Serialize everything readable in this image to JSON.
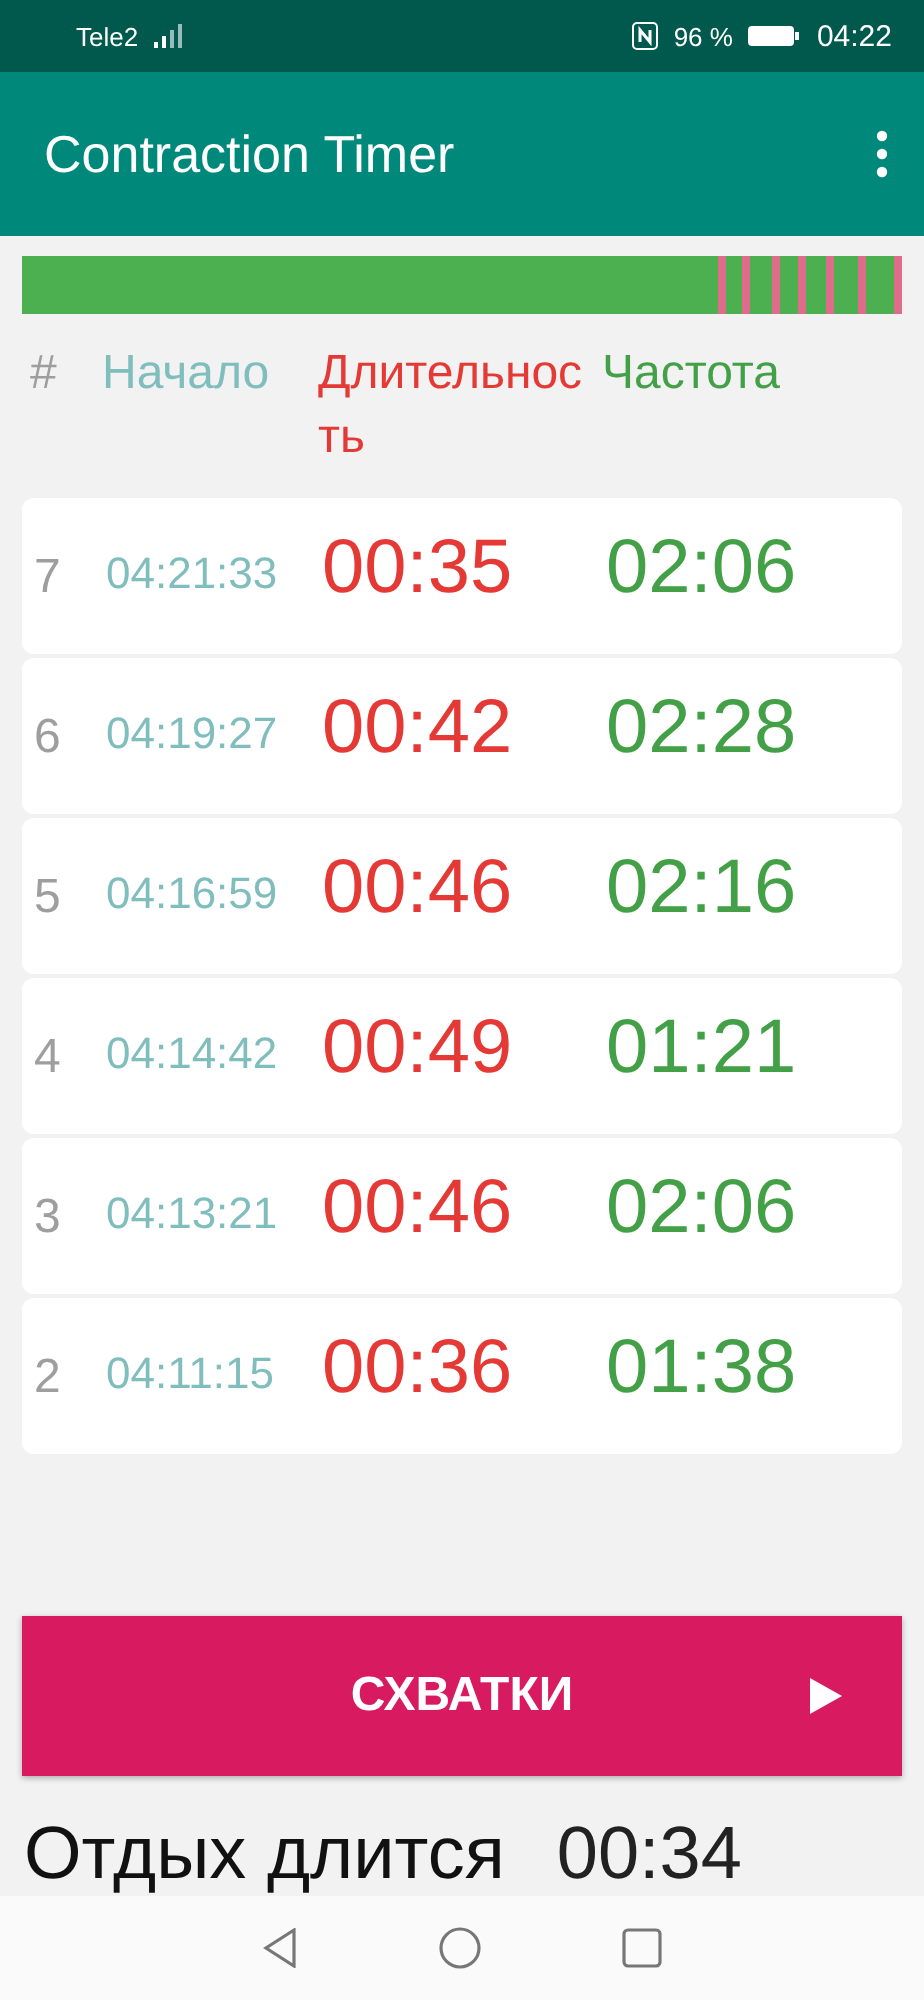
{
  "status_bar": {
    "carrier": "Tele2",
    "battery": "96 %",
    "time": "04:22"
  },
  "app_bar": {
    "title": "Contraction Timer"
  },
  "columns": [
    "#",
    "Начало",
    "Длительность",
    "Частота"
  ],
  "rows": [
    {
      "number": "7",
      "start": "04:21:33",
      "duration": "00:35",
      "frequency": "02:06"
    },
    {
      "number": "6",
      "start": "04:19:27",
      "duration": "00:42",
      "frequency": "02:28"
    },
    {
      "number": "5",
      "start": "04:16:59",
      "duration": "00:46",
      "frequency": "02:16"
    },
    {
      "number": "4",
      "start": "04:14:42",
      "duration": "00:49",
      "frequency": "01:21"
    },
    {
      "number": "3",
      "start": "04:13:21",
      "duration": "00:46",
      "frequency": "02:06"
    },
    {
      "number": "2",
      "start": "04:11:15",
      "duration": "00:36",
      "frequency": "01:38"
    }
  ],
  "action_button": {
    "label": "СХВАТКИ"
  },
  "rest": {
    "label": "Отдых длится",
    "time": "00:34"
  }
}
